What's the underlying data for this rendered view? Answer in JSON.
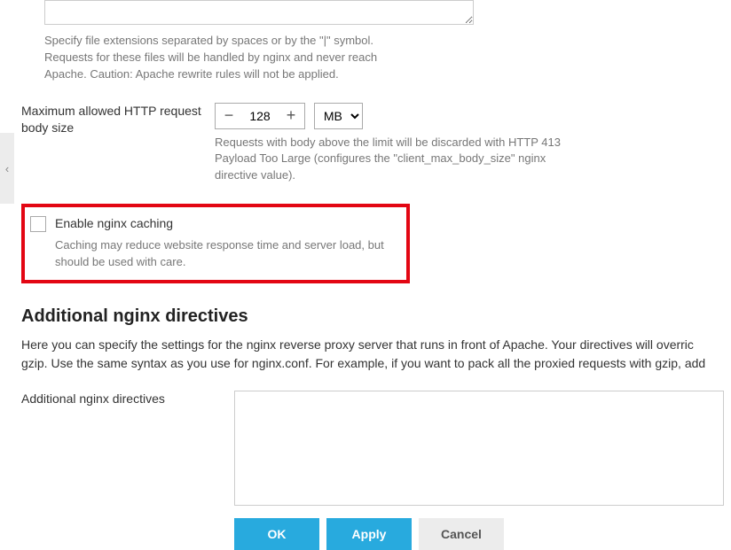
{
  "fileExt": {
    "hint": "Specify file extensions separated by spaces or by the \"|\" symbol. Requests for these files will be handled by nginx and never reach Apache. Caution: Apache rewrite rules will not be applied."
  },
  "bodySize": {
    "label": "Maximum allowed HTTP request body size",
    "value": "128",
    "unit": "MB",
    "hint": "Requests with body above the limit will be discarded with HTTP 413 Payload Too Large (configures the \"client_max_body_size\" nginx directive value)."
  },
  "caching": {
    "label": "Enable nginx caching",
    "hint": "Caching may reduce website response time and server load, but should be used with care."
  },
  "directives": {
    "heading": "Additional nginx directives",
    "desc_line1": "Here you can specify the settings for the nginx reverse proxy server that runs in front of Apache. Your directives will overric",
    "desc_line2": "gzip. Use the same syntax as you use for nginx.conf. For example, if you want to pack all the proxied requests with gzip, add",
    "label": "Additional nginx directives"
  },
  "buttons": {
    "ok": "OK",
    "apply": "Apply",
    "cancel": "Cancel"
  },
  "collapse_glyph": "‹"
}
